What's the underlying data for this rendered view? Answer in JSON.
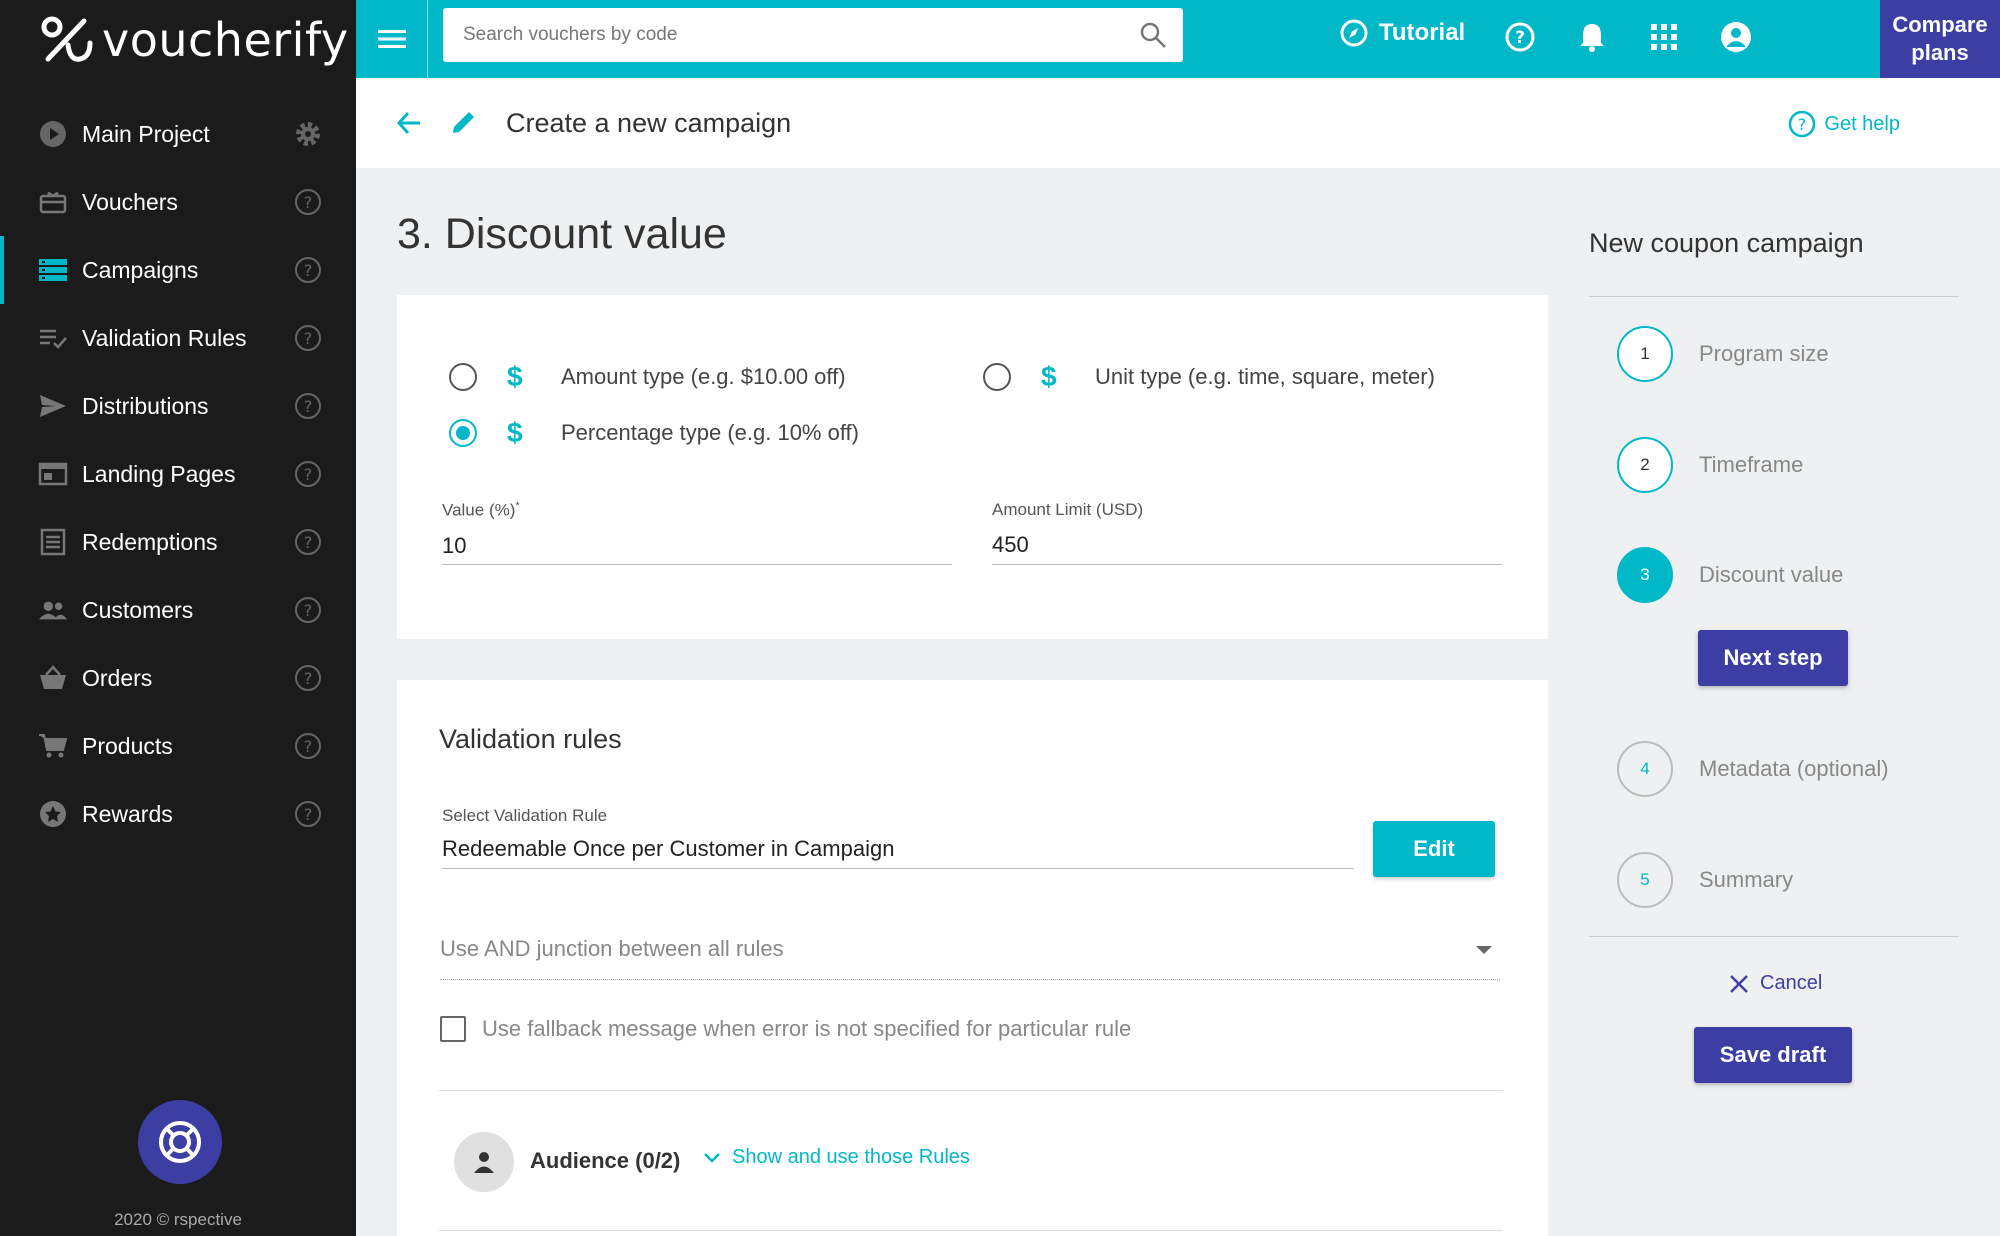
{
  "app": {
    "brand": "voucherify"
  },
  "colors": {
    "accent": "#00b8c8",
    "primary": "#3d3ea3",
    "sidebar": "#1b1b1b"
  },
  "sidebar": {
    "items": [
      {
        "label": "Main Project",
        "icon": "play-circle-icon",
        "trailing": "gear-icon"
      },
      {
        "label": "Vouchers",
        "icon": "gift-card-icon",
        "trailing": "help-icon"
      },
      {
        "label": "Campaigns",
        "icon": "campaigns-icon",
        "trailing": "help-icon",
        "active": true
      },
      {
        "label": "Validation Rules",
        "icon": "checklist-icon",
        "trailing": "help-icon"
      },
      {
        "label": "Distributions",
        "icon": "send-icon",
        "trailing": "help-icon"
      },
      {
        "label": "Landing Pages",
        "icon": "web-page-icon",
        "trailing": "help-icon"
      },
      {
        "label": "Redemptions",
        "icon": "list-icon",
        "trailing": "help-icon"
      },
      {
        "label": "Customers",
        "icon": "people-icon",
        "trailing": "help-icon"
      },
      {
        "label": "Orders",
        "icon": "basket-icon",
        "trailing": "help-icon"
      },
      {
        "label": "Products",
        "icon": "cart-icon",
        "trailing": "help-icon"
      },
      {
        "label": "Rewards",
        "icon": "star-circle-icon",
        "trailing": "help-icon"
      }
    ],
    "copyright": "2020 © rspective"
  },
  "topbar": {
    "search_placeholder": "Search vouchers by code",
    "tutorial": "Tutorial",
    "compare_plans": "Compare plans"
  },
  "header": {
    "title": "Create a new campaign",
    "get_help": "Get help"
  },
  "main": {
    "section_title": "3. Discount value",
    "discount_types": [
      {
        "label": "Amount type (e.g. $10.00 off)",
        "checked": false
      },
      {
        "label": "Unit type (e.g. time, square, meter)",
        "checked": false
      },
      {
        "label": "Percentage type (e.g. 10% off)",
        "checked": true
      }
    ],
    "value_field": {
      "label": "Value (%)",
      "required_mark": "*",
      "value": "10"
    },
    "limit_field": {
      "label": "Amount Limit (USD)",
      "value": "450"
    },
    "validation": {
      "title": "Validation rules",
      "select_label": "Select Validation Rule",
      "select_value": "Redeemable Once per Customer in Campaign",
      "edit_button": "Edit",
      "junction_placeholder": "Use AND junction between all rules",
      "fallback_checkbox": "Use fallback message when error is not specified for particular rule",
      "audience_label": "Audience (0/2)",
      "audience_link": "Show and use those Rules"
    }
  },
  "steps": {
    "title": "New coupon campaign",
    "items": [
      {
        "number": "1",
        "label": "Program size",
        "state": "done"
      },
      {
        "number": "2",
        "label": "Timeframe",
        "state": "done"
      },
      {
        "number": "3",
        "label": "Discount value",
        "state": "active"
      },
      {
        "number": "4",
        "label": "Metadata (optional)",
        "state": "future"
      },
      {
        "number": "5",
        "label": "Summary",
        "state": "future"
      }
    ],
    "next_button": "Next step",
    "cancel": "Cancel",
    "save_draft": "Save draft"
  }
}
